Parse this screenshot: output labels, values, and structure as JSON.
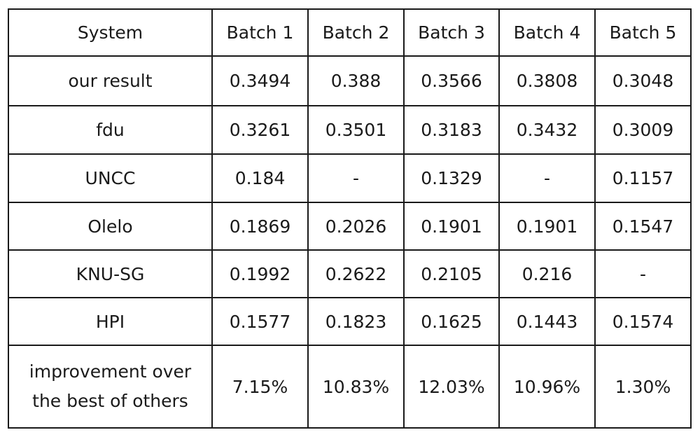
{
  "table": {
    "headers": [
      "System",
      "Batch 1",
      "Batch 2",
      "Batch 3",
      "Batch 4",
      "Batch 5"
    ],
    "rows": [
      {
        "system": "our result",
        "values": [
          "0.3494",
          "0.388",
          "0.3566",
          "0.3808",
          "0.3048"
        ]
      },
      {
        "system": "fdu",
        "values": [
          "0.3261",
          "0.3501",
          "0.3183",
          "0.3432",
          "0.3009"
        ]
      },
      {
        "system": "UNCC",
        "values": [
          "0.184",
          "-",
          "0.1329",
          "-",
          "0.1157"
        ]
      },
      {
        "system": "Olelo",
        "values": [
          "0.1869",
          "0.2026",
          "0.1901",
          "0.1901",
          "0.1547"
        ]
      },
      {
        "system": "KNU-SG",
        "values": [
          "0.1992",
          "0.2622",
          "0.2105",
          "0.216",
          "-"
        ]
      },
      {
        "system": "HPI",
        "values": [
          "0.1577",
          "0.1823",
          "0.1625",
          "0.1443",
          "0.1574"
        ]
      },
      {
        "system": "improvement over\nthe best of others",
        "values": [
          "7.15%",
          "10.83%",
          "12.03%",
          "10.96%",
          "1.30%"
        ]
      }
    ]
  }
}
